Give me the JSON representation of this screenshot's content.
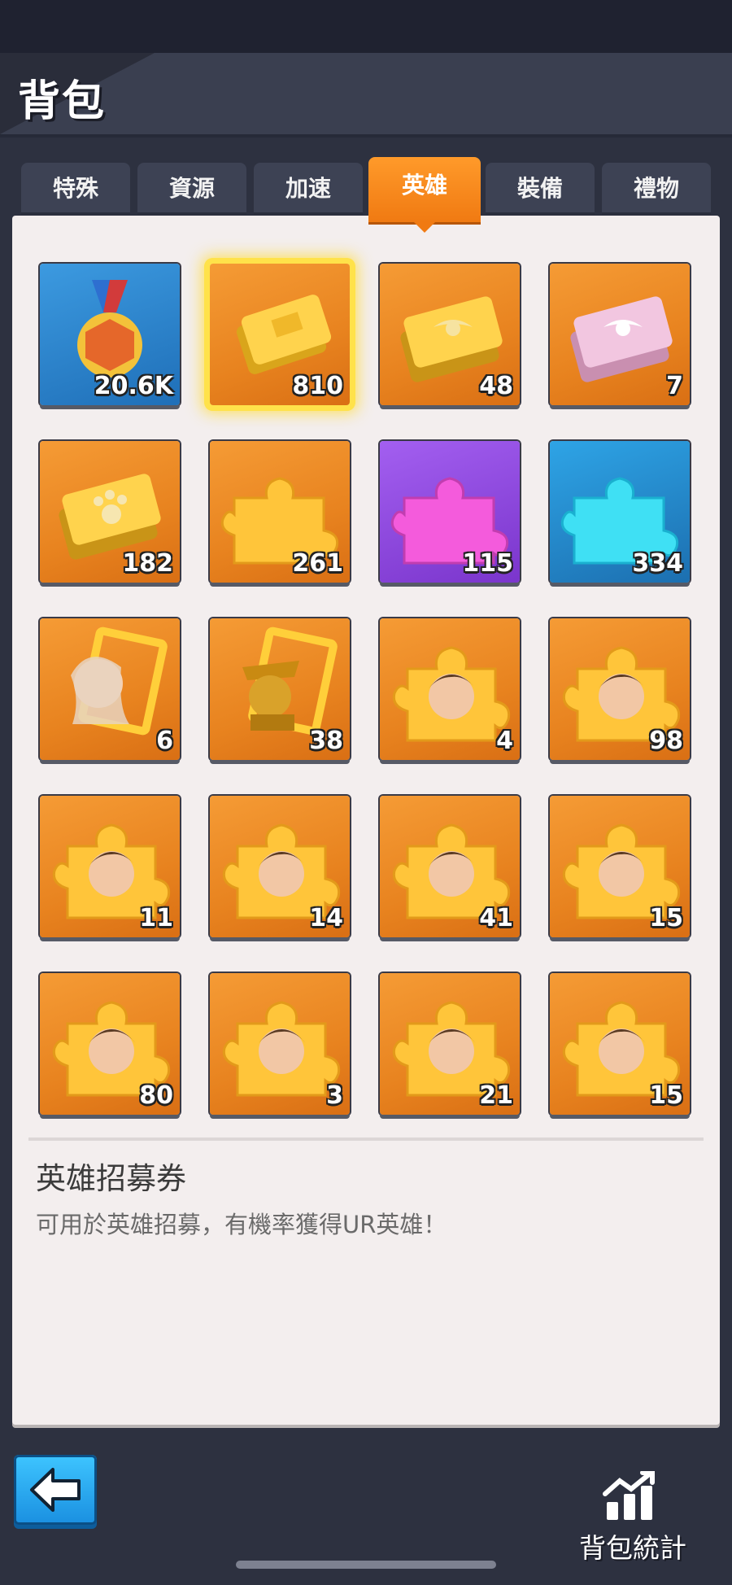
{
  "header": {
    "title": "背包"
  },
  "tabs": [
    {
      "label": "特殊",
      "active": false
    },
    {
      "label": "資源",
      "active": false
    },
    {
      "label": "加速",
      "active": false
    },
    {
      "label": "英雄",
      "active": true
    },
    {
      "label": "裝備",
      "active": false
    },
    {
      "label": "禮物",
      "active": false
    }
  ],
  "items": [
    {
      "icon": "medal-icon",
      "count": "20.6K"
    },
    {
      "icon": "gold-ticket-icon",
      "count": "810",
      "selected": true
    },
    {
      "icon": "gold-eagle-ticket-icon",
      "count": "48"
    },
    {
      "icon": "pink-eagle-ticket-icon",
      "count": "7"
    },
    {
      "icon": "paw-ticket-icon",
      "count": "182"
    },
    {
      "icon": "gold-puzzle-icon",
      "count": "261"
    },
    {
      "icon": "purple-puzzle-icon",
      "count": "115"
    },
    {
      "icon": "blue-puzzle-icon",
      "count": "334"
    },
    {
      "icon": "hero-frame-woman-icon",
      "count": "6"
    },
    {
      "icon": "hero-frame-officer-icon",
      "count": "38"
    },
    {
      "icon": "hero-fragment-icon",
      "count": "4"
    },
    {
      "icon": "hero-fragment-icon",
      "count": "98"
    },
    {
      "icon": "hero-fragment-icon",
      "count": "11"
    },
    {
      "icon": "hero-fragment-icon",
      "count": "14"
    },
    {
      "icon": "hero-fragment-icon",
      "count": "41"
    },
    {
      "icon": "hero-fragment-icon",
      "count": "15"
    },
    {
      "icon": "hero-fragment-icon",
      "count": "80"
    },
    {
      "icon": "hero-fragment-icon",
      "count": "3"
    },
    {
      "icon": "hero-fragment-icon",
      "count": "21"
    },
    {
      "icon": "hero-fragment-icon",
      "count": "15"
    }
  ],
  "description": {
    "title": "英雄招募券",
    "text": "可用於英雄招募，有機率獲得UR英雄！"
  },
  "footer": {
    "stats_label": "背包統計"
  },
  "colors": {
    "accent": "#f07a12",
    "selected_glow": "#ffe24a",
    "back_button": "#1a8fe0"
  }
}
